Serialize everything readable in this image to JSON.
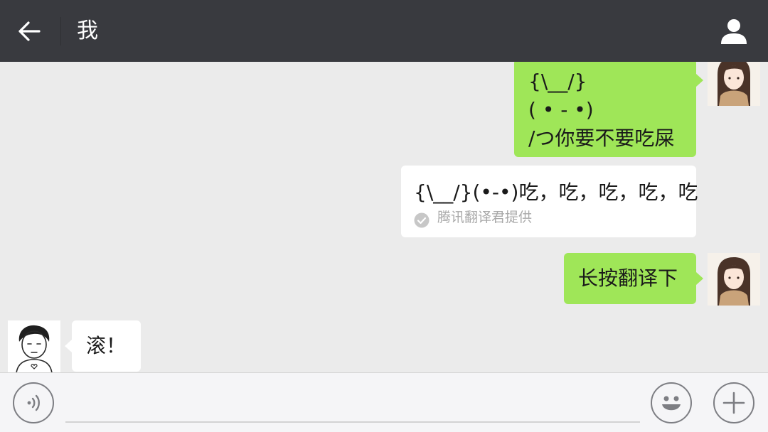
{
  "header": {
    "title": "我",
    "back_icon": "arrow-left-icon",
    "profile_icon": "person-icon"
  },
  "messages": [
    {
      "sender": "me",
      "lines": [
        "{\\__/}",
        "( • - •)",
        "/つ你要不要吃屎"
      ]
    },
    {
      "sender": "translation",
      "text": "{\\__/}(•-•)吃，吃，吃，吃，吃",
      "note": "腾讯翻译君提供"
    },
    {
      "sender": "me",
      "lines": [
        "长按翻译下"
      ]
    },
    {
      "sender": "other",
      "lines": [
        "滚！"
      ]
    }
  ],
  "bottom_bar": {
    "voice_icon": "voice-icon",
    "emoji_icon": "emoji-icon",
    "add_icon": "plus-icon",
    "input_value": ""
  },
  "colors": {
    "header_bg": "#393a3f",
    "chat_bg": "#ebebeb",
    "my_bubble": "#9fe658",
    "other_bubble": "#ffffff"
  }
}
